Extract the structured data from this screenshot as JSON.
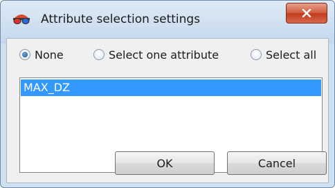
{
  "window": {
    "title": "Attribute selection settings",
    "close_glyph": "x"
  },
  "selection_mode": {
    "options": [
      {
        "label": "None",
        "selected": true
      },
      {
        "label": "Select one attribute",
        "selected": false
      },
      {
        "label": "Select all",
        "selected": false
      }
    ]
  },
  "attributes": {
    "items": [
      {
        "label": "MAX_DZ",
        "selected": true
      }
    ]
  },
  "buttons": {
    "ok_label": "OK",
    "cancel_label": "Cancel"
  },
  "colors": {
    "selection": "#3399ff",
    "close_button": "#c23a1c"
  }
}
